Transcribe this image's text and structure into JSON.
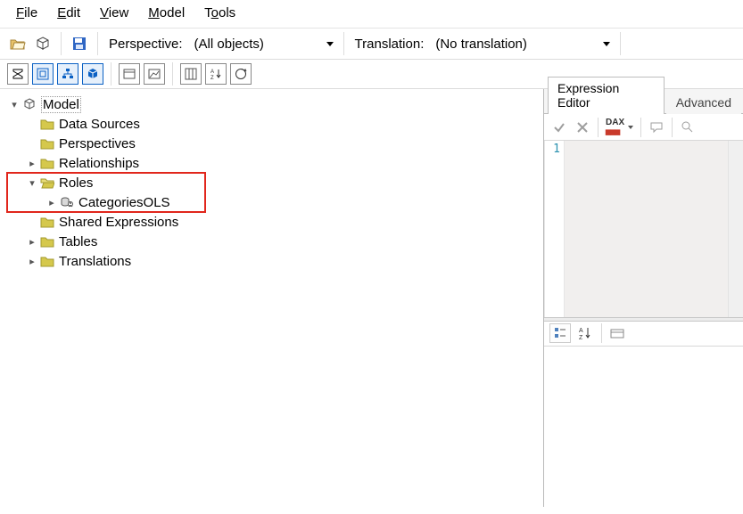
{
  "menu": {
    "file": "File",
    "edit": "Edit",
    "view": "View",
    "model": "Model",
    "tools": "Tools"
  },
  "toolbar": {
    "perspective_label": "Perspective:",
    "perspective_value": "(All objects)",
    "translation_label": "Translation:",
    "translation_value": "(No translation)"
  },
  "tree": {
    "root": "Model",
    "items": [
      {
        "label": "Data Sources",
        "expandable": false
      },
      {
        "label": "Perspectives",
        "expandable": false
      },
      {
        "label": "Relationships",
        "expandable": true
      },
      {
        "label": "Roles",
        "expandable": true
      },
      {
        "label": "Shared Expressions",
        "expandable": false
      },
      {
        "label": "Tables",
        "expandable": true
      },
      {
        "label": "Translations",
        "expandable": true
      }
    ],
    "roles_child": "CategoriesOLS"
  },
  "right": {
    "tab_active": "Expression Editor",
    "tab_inactive": "Advanced",
    "gutter_line": "1",
    "dax_label": "DAX"
  }
}
